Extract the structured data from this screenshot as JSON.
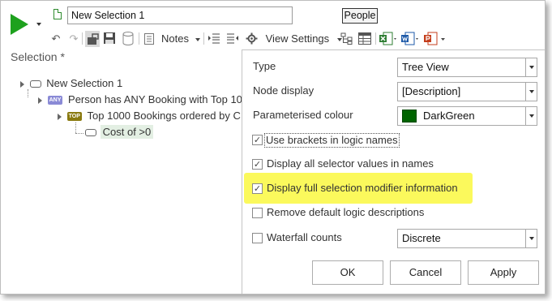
{
  "title_input": {
    "value": "New Selection 1"
  },
  "people_button": {
    "label": "People"
  },
  "toolbar": {
    "notes_label": "Notes",
    "view_settings_label": "View Settings",
    "icons": [
      "undo-icon",
      "redo-icon",
      "lock-icon",
      "save-icon",
      "database-icon",
      "notes-icon",
      "indent-icon",
      "outdent-icon",
      "view-settings-icon",
      "hierarchy-icon",
      "grid-icon",
      "excel-icon",
      "word-icon",
      "powerpoint-icon"
    ]
  },
  "selection_label": "Selection *",
  "tree": {
    "root": "New Selection 1",
    "node1_badge": "ANY",
    "node1": "Person has ANY Booking with Top 10",
    "node2_badge": "TOP",
    "node2": "Top 1000 Bookings ordered by C",
    "node3": "Cost of >0"
  },
  "panel": {
    "type_label": "Type",
    "type_value": "Tree View",
    "node_display_label": "Node display",
    "node_display_value": "[Description]",
    "param_colour_label": "Parameterised colour",
    "param_colour_value": "DarkGreen",
    "param_colour_hex": "#006400",
    "checkboxes": [
      {
        "label": "Use brackets in logic names",
        "checked": true
      },
      {
        "label": "Display all selector values in names",
        "checked": true
      },
      {
        "label": "Display full selection modifier information",
        "checked": true
      },
      {
        "label": "Remove default logic descriptions",
        "checked": false
      },
      {
        "label": "Waterfall counts",
        "checked": false
      }
    ],
    "waterfall_value": "Discrete",
    "ok_label": "OK",
    "cancel_label": "Cancel",
    "apply_label": "Apply",
    "highlight_color": "#fbf95c"
  }
}
